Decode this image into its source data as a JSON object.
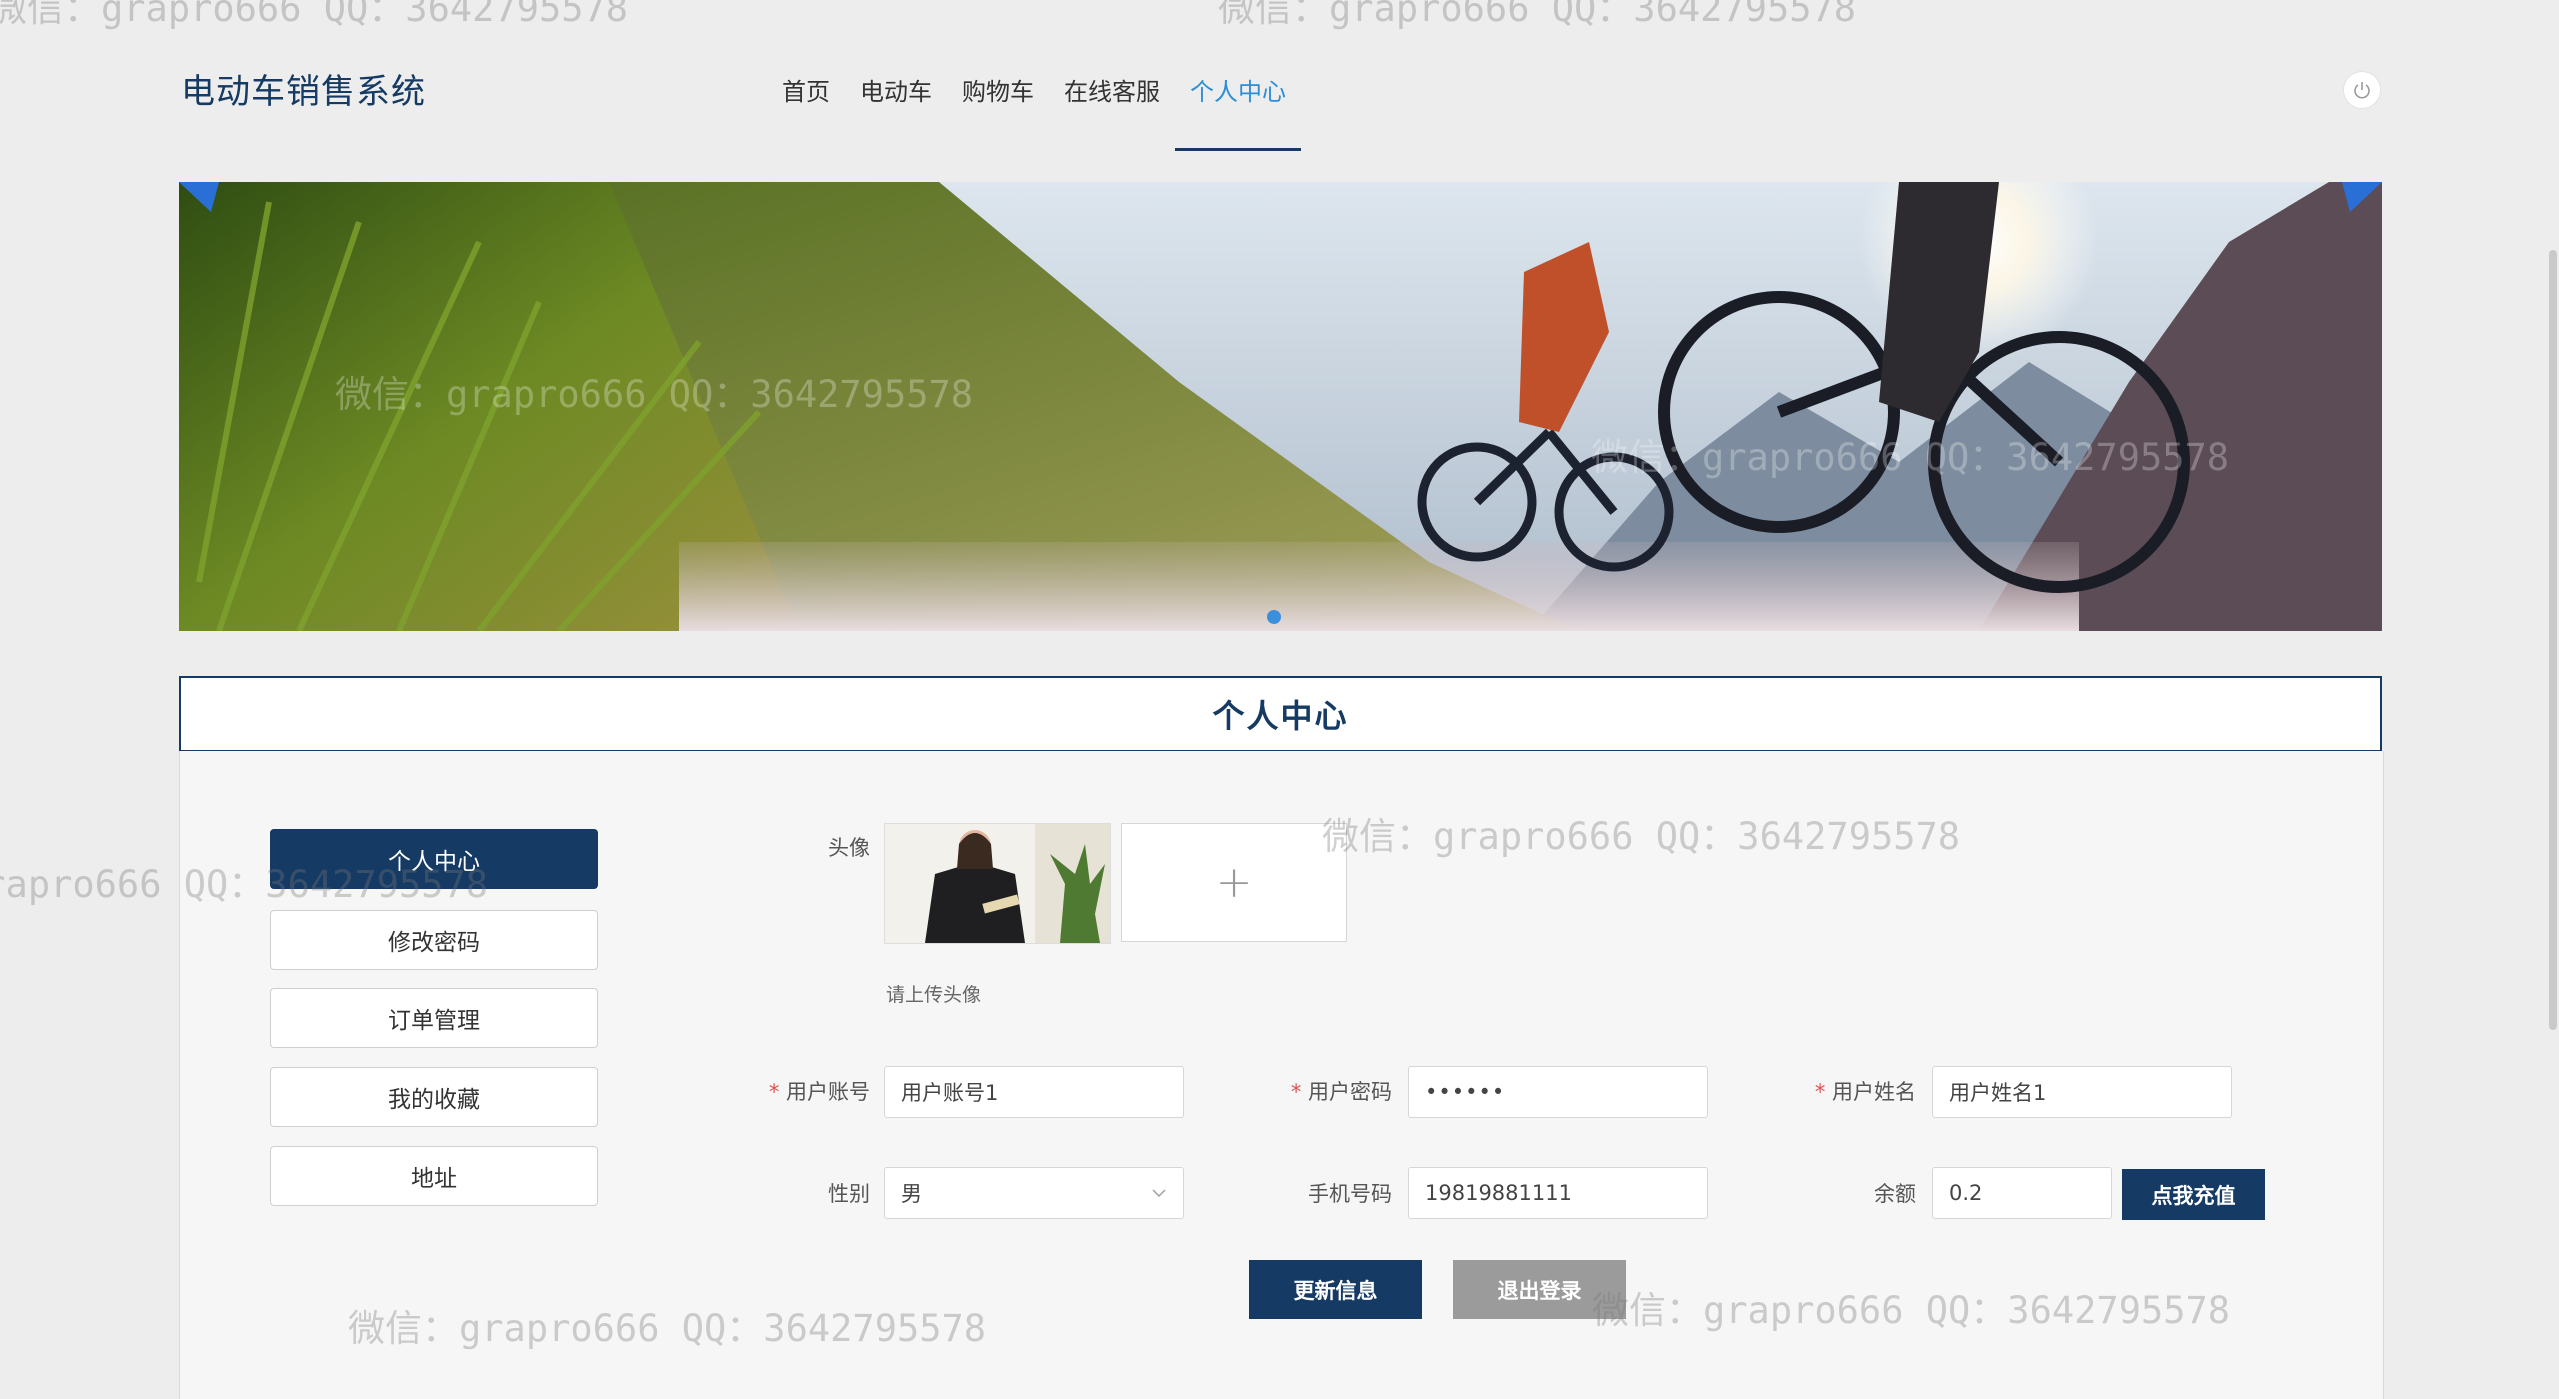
{
  "header": {
    "site_title": "电动车销售系统",
    "nav": [
      {
        "label": "首页"
      },
      {
        "label": "电动车"
      },
      {
        "label": "购物车"
      },
      {
        "label": "在线客服"
      },
      {
        "label": "个人中心",
        "active": true
      }
    ],
    "power_icon": "power-icon"
  },
  "banner": {
    "image": "mountain-bike-riders-splashing-water"
  },
  "section": {
    "title": "个人中心"
  },
  "menu": {
    "items": [
      {
        "label": "个人中心",
        "active": true
      },
      {
        "label": "修改密码"
      },
      {
        "label": "订单管理"
      },
      {
        "label": "我的收藏"
      },
      {
        "label": "地址"
      }
    ]
  },
  "form": {
    "avatar_label": "头像",
    "upload_icon": "plus-icon",
    "upload_symbol": "+",
    "upload_hint": "请上传头像",
    "account_label": "用户账号",
    "account_value": "用户账号1",
    "password_label": "用户密码",
    "password_value": "••••••",
    "name_label": "用户姓名",
    "name_value": "用户姓名1",
    "gender_label": "性别",
    "gender_value": "男",
    "phone_label": "手机号码",
    "phone_value": "19819881111",
    "balance_label": "余额",
    "balance_value": "0.2",
    "recharge_button": "点我充值",
    "update_button": "更新信息",
    "logout_button": "退出登录"
  },
  "watermark": "微信：grapro666 QQ：3642795578",
  "colors": {
    "primary": "#153a63",
    "accent": "#2b8ed9",
    "required": "#e05050",
    "gray_button": "#9b9b9b"
  }
}
